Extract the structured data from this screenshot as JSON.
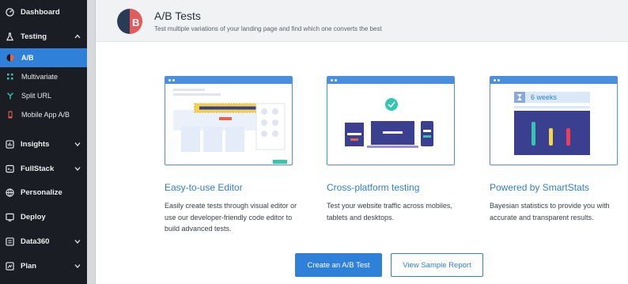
{
  "sidebar": {
    "items": [
      {
        "label": "Dashboard",
        "icon": "dashboard-icon"
      },
      {
        "label": "Testing",
        "icon": "flask-icon",
        "expanded": true
      },
      {
        "label": "Insights",
        "icon": "insights-icon"
      },
      {
        "label": "FullStack",
        "icon": "fullstack-icon"
      },
      {
        "label": "Personalize",
        "icon": "globe-icon"
      },
      {
        "label": "Deploy",
        "icon": "deploy-icon"
      },
      {
        "label": "Data360",
        "icon": "data360-icon"
      },
      {
        "label": "Plan",
        "icon": "plan-icon"
      }
    ],
    "testing_sub": [
      {
        "label": "A/B",
        "active": true
      },
      {
        "label": "Multivariate"
      },
      {
        "label": "Split URL"
      },
      {
        "label": "Mobile App A/B"
      }
    ]
  },
  "header": {
    "logo_text": "B",
    "title": "A/B Tests",
    "subtitle": "Test multiple variations of your landing page and find which one converts the best"
  },
  "cards": [
    {
      "title": "Easy-to-use Editor",
      "description": "Easily create tests through visual editor or use our developer-friendly code editor to build advanced tests."
    },
    {
      "title": "Cross-platform testing",
      "description": "Test your website traffic across mobiles, tablets and desktops."
    },
    {
      "title": "Powered by SmartStats",
      "description": "Bayesian statistics to provide you with accurate and transparent results.",
      "badge": "6 weeks"
    }
  ],
  "actions": {
    "create_label": "Create an A/B Test",
    "sample_label": "View Sample Report"
  },
  "colors": {
    "sidebar_bg": "#1a1d23",
    "accent": "#2f80d9",
    "header_bg": "#f1f2f4"
  }
}
